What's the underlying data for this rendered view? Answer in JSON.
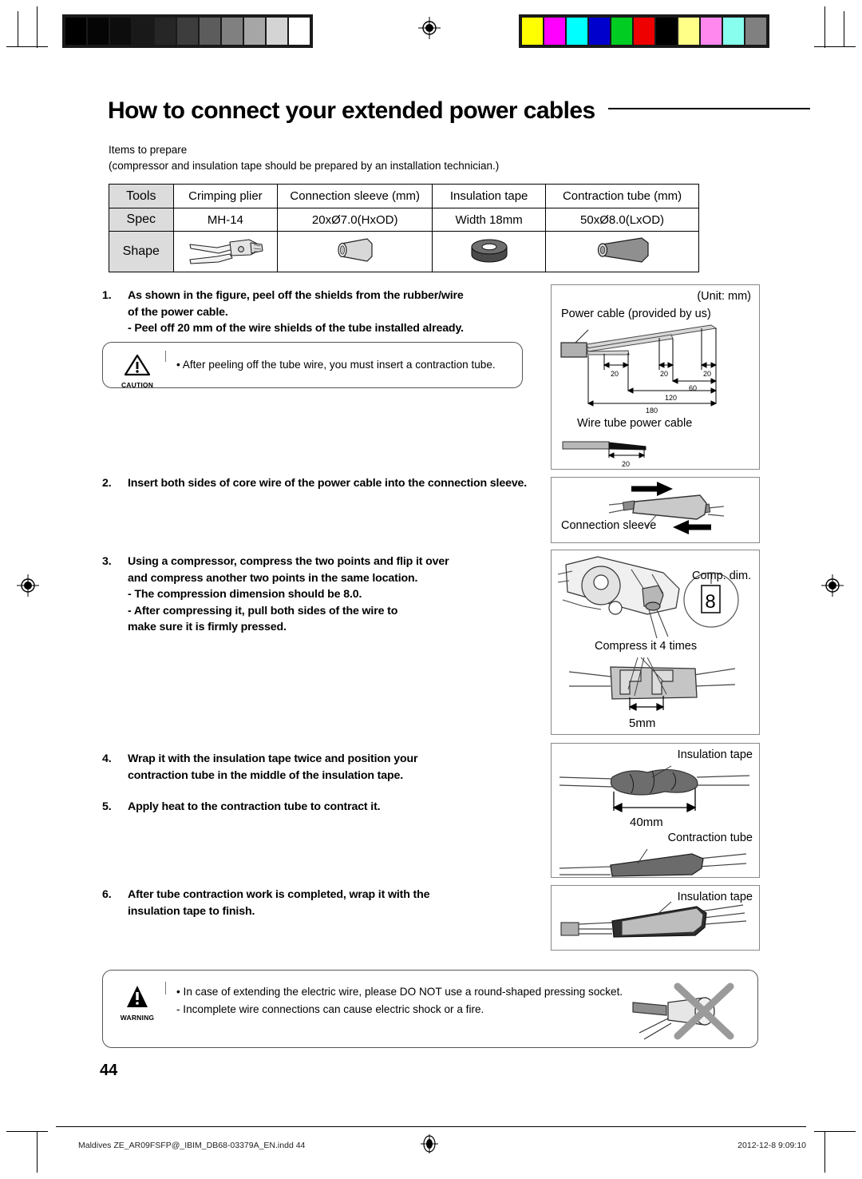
{
  "document": {
    "title": "How to connect your extended power cables",
    "intro_line1": "Items to prepare",
    "intro_line2": "(compressor and insulation tape should be prepared by an installation technician.)",
    "page_number": "44"
  },
  "spec_table": {
    "rows": [
      {
        "label": "Tools",
        "cells": [
          "Crimping plier",
          "Connection sleeve (mm)",
          "Insulation tape",
          "Contraction tube (mm)"
        ]
      },
      {
        "label": "Spec",
        "cells": [
          "MH-14",
          "20xØ7.0(HxOD)",
          "Width 18mm",
          "50xØ8.0(LxOD)"
        ]
      },
      {
        "label": "Shape",
        "cells": [
          "",
          "",
          "",
          ""
        ]
      }
    ],
    "shape_icons": [
      "crimping-plier-icon",
      "connection-sleeve-icon",
      "insulation-tape-roll-icon",
      "contraction-tube-icon"
    ]
  },
  "steps": [
    {
      "number": "1.",
      "lines": [
        "As shown in the figure, peel off the shields from the  rubber/wire",
        "of the power cable.",
        "- Peel off 20 mm of the wire shields of the tube installed already."
      ]
    },
    {
      "number": "2.",
      "lines": [
        "Insert both sides of core wire of the power cable into the connection sleeve."
      ]
    },
    {
      "number": "3.",
      "lines": [
        "Using a compressor, compress the two points and flip it over",
        " and compress another two points in the same location.",
        "- The compression dimension should be 8.0.",
        "- After compressing it, pull both sides of the wire to",
        "  make sure it is firmly pressed."
      ]
    },
    {
      "number": "4.",
      "lines": [
        "Wrap it with the insulation tape twice and position your",
        "contraction tube in the middle of the insulation tape."
      ]
    },
    {
      "number": "5.",
      "lines": [
        "Apply heat to the contraction tube to contract it."
      ]
    },
    {
      "number": "6.",
      "lines": [
        "After tube contraction work is completed, wrap it with the",
        " insulation tape to finish."
      ]
    }
  ],
  "caution_box": {
    "label": "CAUTION",
    "lines": [
      "•  After peeling off the tube wire, you must insert a contraction tube."
    ]
  },
  "warning_box": {
    "label": "WARNING",
    "lines": [
      "•  In case of extending the electric wire, please DO NOT use a round-shaped pressing socket.",
      "   - Incomplete wire connections can cause electric shock or a fire."
    ]
  },
  "figures": {
    "power_cable": {
      "unit": "(Unit: mm)",
      "caption": "Power cable (provided by us)",
      "sub_caption": "Wire tube power cable",
      "dims": [
        "20",
        "20",
        "20",
        "60",
        "120",
        "180"
      ],
      "wire_tube_dim": "20"
    },
    "connection_sleeve": {
      "caption": "Connection sleeve"
    },
    "compression": {
      "comp_dim_label": "Comp. dim.",
      "comp_dim_value": "8",
      "compress_label": "Compress it 4 times",
      "spacing": "5mm"
    },
    "tape_tube": {
      "tape_label": "Insulation tape",
      "tape_dim": "40mm",
      "tube_label": "Contraction tube"
    },
    "final_tape": {
      "label": "Insulation tape"
    }
  },
  "footer": {
    "filename": "Maldives ZE_AR09FSFP@_IBIM_DB68-03379A_EN.indd   44",
    "timestamp": "2012-12-8   9:09:10"
  },
  "calibration": {
    "grayscale": [
      "#000000",
      "#050505",
      "#0d0d0d",
      "#191919",
      "#262626",
      "#3d3d3d",
      "#5c5c5c",
      "#808080",
      "#a6a6a6",
      "#d4d4d4",
      "#ffffff"
    ],
    "colors": [
      "#ffff00",
      "#ff00ff",
      "#00ffff",
      "#0000cc",
      "#00cc22",
      "#ee0000",
      "#000000",
      "#ffff88",
      "#ff88ee",
      "#88ffee",
      "#808080"
    ]
  }
}
